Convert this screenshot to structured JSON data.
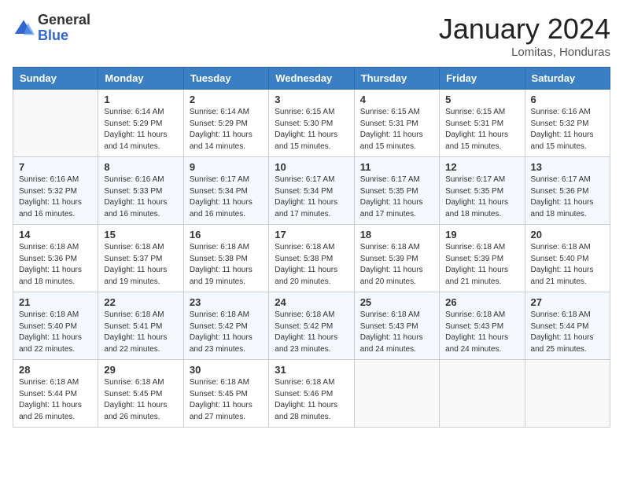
{
  "header": {
    "logo_general": "General",
    "logo_blue": "Blue",
    "month_title": "January 2024",
    "location": "Lomitas, Honduras"
  },
  "days_of_week": [
    "Sunday",
    "Monday",
    "Tuesday",
    "Wednesday",
    "Thursday",
    "Friday",
    "Saturday"
  ],
  "weeks": [
    [
      {
        "day": "",
        "sunrise": "",
        "sunset": "",
        "daylight": ""
      },
      {
        "day": "1",
        "sunrise": "6:14 AM",
        "sunset": "5:29 PM",
        "daylight": "11 hours and 14 minutes."
      },
      {
        "day": "2",
        "sunrise": "6:14 AM",
        "sunset": "5:29 PM",
        "daylight": "11 hours and 14 minutes."
      },
      {
        "day": "3",
        "sunrise": "6:15 AM",
        "sunset": "5:30 PM",
        "daylight": "11 hours and 15 minutes."
      },
      {
        "day": "4",
        "sunrise": "6:15 AM",
        "sunset": "5:31 PM",
        "daylight": "11 hours and 15 minutes."
      },
      {
        "day": "5",
        "sunrise": "6:15 AM",
        "sunset": "5:31 PM",
        "daylight": "11 hours and 15 minutes."
      },
      {
        "day": "6",
        "sunrise": "6:16 AM",
        "sunset": "5:32 PM",
        "daylight": "11 hours and 15 minutes."
      }
    ],
    [
      {
        "day": "7",
        "sunrise": "6:16 AM",
        "sunset": "5:32 PM",
        "daylight": "11 hours and 16 minutes."
      },
      {
        "day": "8",
        "sunrise": "6:16 AM",
        "sunset": "5:33 PM",
        "daylight": "11 hours and 16 minutes."
      },
      {
        "day": "9",
        "sunrise": "6:17 AM",
        "sunset": "5:34 PM",
        "daylight": "11 hours and 16 minutes."
      },
      {
        "day": "10",
        "sunrise": "6:17 AM",
        "sunset": "5:34 PM",
        "daylight": "11 hours and 17 minutes."
      },
      {
        "day": "11",
        "sunrise": "6:17 AM",
        "sunset": "5:35 PM",
        "daylight": "11 hours and 17 minutes."
      },
      {
        "day": "12",
        "sunrise": "6:17 AM",
        "sunset": "5:35 PM",
        "daylight": "11 hours and 18 minutes."
      },
      {
        "day": "13",
        "sunrise": "6:17 AM",
        "sunset": "5:36 PM",
        "daylight": "11 hours and 18 minutes."
      }
    ],
    [
      {
        "day": "14",
        "sunrise": "6:18 AM",
        "sunset": "5:36 PM",
        "daylight": "11 hours and 18 minutes."
      },
      {
        "day": "15",
        "sunrise": "6:18 AM",
        "sunset": "5:37 PM",
        "daylight": "11 hours and 19 minutes."
      },
      {
        "day": "16",
        "sunrise": "6:18 AM",
        "sunset": "5:38 PM",
        "daylight": "11 hours and 19 minutes."
      },
      {
        "day": "17",
        "sunrise": "6:18 AM",
        "sunset": "5:38 PM",
        "daylight": "11 hours and 20 minutes."
      },
      {
        "day": "18",
        "sunrise": "6:18 AM",
        "sunset": "5:39 PM",
        "daylight": "11 hours and 20 minutes."
      },
      {
        "day": "19",
        "sunrise": "6:18 AM",
        "sunset": "5:39 PM",
        "daylight": "11 hours and 21 minutes."
      },
      {
        "day": "20",
        "sunrise": "6:18 AM",
        "sunset": "5:40 PM",
        "daylight": "11 hours and 21 minutes."
      }
    ],
    [
      {
        "day": "21",
        "sunrise": "6:18 AM",
        "sunset": "5:40 PM",
        "daylight": "11 hours and 22 minutes."
      },
      {
        "day": "22",
        "sunrise": "6:18 AM",
        "sunset": "5:41 PM",
        "daylight": "11 hours and 22 minutes."
      },
      {
        "day": "23",
        "sunrise": "6:18 AM",
        "sunset": "5:42 PM",
        "daylight": "11 hours and 23 minutes."
      },
      {
        "day": "24",
        "sunrise": "6:18 AM",
        "sunset": "5:42 PM",
        "daylight": "11 hours and 23 minutes."
      },
      {
        "day": "25",
        "sunrise": "6:18 AM",
        "sunset": "5:43 PM",
        "daylight": "11 hours and 24 minutes."
      },
      {
        "day": "26",
        "sunrise": "6:18 AM",
        "sunset": "5:43 PM",
        "daylight": "11 hours and 24 minutes."
      },
      {
        "day": "27",
        "sunrise": "6:18 AM",
        "sunset": "5:44 PM",
        "daylight": "11 hours and 25 minutes."
      }
    ],
    [
      {
        "day": "28",
        "sunrise": "6:18 AM",
        "sunset": "5:44 PM",
        "daylight": "11 hours and 26 minutes."
      },
      {
        "day": "29",
        "sunrise": "6:18 AM",
        "sunset": "5:45 PM",
        "daylight": "11 hours and 26 minutes."
      },
      {
        "day": "30",
        "sunrise": "6:18 AM",
        "sunset": "5:45 PM",
        "daylight": "11 hours and 27 minutes."
      },
      {
        "day": "31",
        "sunrise": "6:18 AM",
        "sunset": "5:46 PM",
        "daylight": "11 hours and 28 minutes."
      },
      {
        "day": "",
        "sunrise": "",
        "sunset": "",
        "daylight": ""
      },
      {
        "day": "",
        "sunrise": "",
        "sunset": "",
        "daylight": ""
      },
      {
        "day": "",
        "sunrise": "",
        "sunset": "",
        "daylight": ""
      }
    ]
  ],
  "labels": {
    "sunrise_prefix": "Sunrise: ",
    "sunset_prefix": "Sunset: ",
    "daylight_prefix": "Daylight: "
  }
}
